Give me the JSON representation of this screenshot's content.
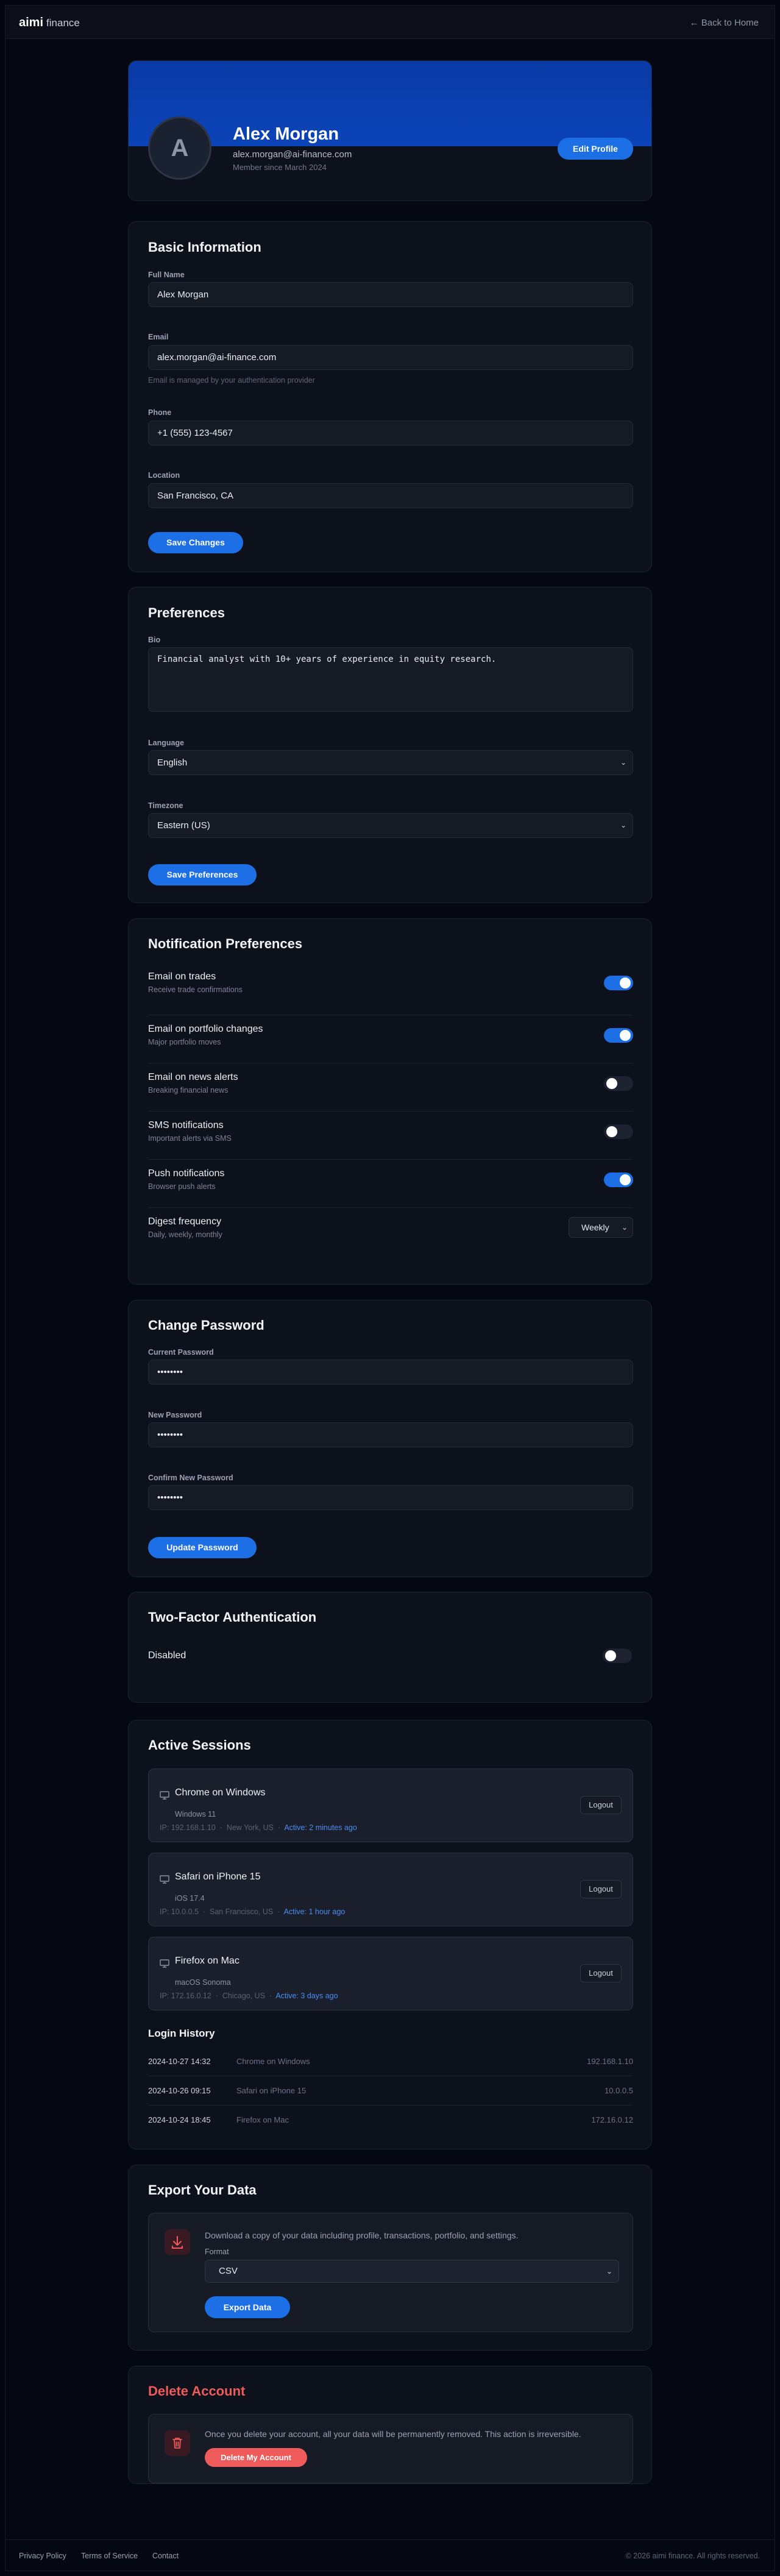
{
  "brand": {
    "logo": "aimi",
    "suffix": "finance"
  },
  "nav": {
    "back": "← Back to Home"
  },
  "profile": {
    "initial": "A",
    "name": "Alex Morgan",
    "email": "alex.morgan@ai-finance.com",
    "member_since": "Member since March 2024",
    "edit_label": "Edit Profile"
  },
  "basic": {
    "title": "Basic Information",
    "full_name": {
      "label": "Full Name",
      "value": "Alex Morgan"
    },
    "email": {
      "label": "Email",
      "value": "alex.morgan@ai-finance.com",
      "hint": "Email is managed by your authentication provider"
    },
    "phone": {
      "label": "Phone",
      "value": "+1 (555) 123-4567"
    },
    "location": {
      "label": "Location",
      "value": "San Francisco, CA"
    },
    "save_label": "Save Changes"
  },
  "prefs": {
    "title": "Preferences",
    "bio": {
      "label": "Bio",
      "value": "Financial analyst with 10+ years of experience in equity research."
    },
    "language": {
      "label": "Language",
      "value": "English"
    },
    "timezone": {
      "label": "Timezone",
      "value": "Eastern (US)"
    },
    "save_label": "Save Preferences"
  },
  "notifications": {
    "title": "Notification Preferences",
    "items": [
      {
        "title": "Email on trades",
        "subtitle": "Receive trade confirmations",
        "on": true
      },
      {
        "title": "Email on portfolio changes",
        "subtitle": "Major portfolio moves",
        "on": true
      },
      {
        "title": "Email on news alerts",
        "subtitle": "Breaking financial news",
        "on": false
      },
      {
        "title": "SMS notifications",
        "subtitle": "Important alerts via SMS",
        "on": false
      },
      {
        "title": "Push notifications",
        "subtitle": "Browser push alerts",
        "on": true
      }
    ],
    "digest": {
      "title": "Digest frequency",
      "subtitle": "Daily, weekly, monthly",
      "value": "Weekly"
    }
  },
  "password": {
    "title": "Change Password",
    "current": {
      "label": "Current Password",
      "value": "••••••••"
    },
    "new": {
      "label": "New Password",
      "value": "••••••••"
    },
    "confirm": {
      "label": "Confirm New Password",
      "value": "••••••••"
    },
    "update_label": "Update Password"
  },
  "twofa": {
    "title": "Two-Factor Authentication",
    "status": "Disabled",
    "on": false
  },
  "sessions": {
    "title": "Active Sessions",
    "logout_label": "Logout",
    "items": [
      {
        "device": "Chrome on Windows",
        "os": "Windows 11",
        "ip": "IP: 192.168.1.10",
        "location": "New York, US",
        "active": "Active: 2 minutes ago"
      },
      {
        "device": "Safari on iPhone 15",
        "os": "iOS 17.4",
        "ip": "IP: 10.0.0.5",
        "location": "San Francisco, US",
        "active": "Active: 1 hour ago"
      },
      {
        "device": "Firefox on Mac",
        "os": "macOS Sonoma",
        "ip": "IP: 172.16.0.12",
        "location": "Chicago, US",
        "active": "Active: 3 days ago"
      }
    ],
    "history_title": "Login History",
    "history": [
      {
        "date": "2024-10-27 14:32",
        "browser": "Chrome on Windows",
        "ip": "192.168.1.10"
      },
      {
        "date": "2024-10-26 09:15",
        "browser": "Safari on iPhone 15",
        "ip": "10.0.0.5"
      },
      {
        "date": "2024-10-24 18:45",
        "browser": "Firefox on Mac",
        "ip": "172.16.0.12"
      }
    ]
  },
  "export": {
    "title": "Export Your Data",
    "description": "Download a copy of your data including profile, transactions, portfolio, and settings.",
    "format_label": "Format",
    "format_value": "CSV",
    "button": "Export Data"
  },
  "delete": {
    "title": "Delete Account",
    "description": "Once you delete your account, all your data will be permanently removed. This action is irreversible.",
    "button": "Delete My Account"
  },
  "footer": {
    "links": [
      "Privacy Policy",
      "Terms of Service",
      "Contact"
    ],
    "copyright": "© 2026 aimi finance. All rights reserved."
  },
  "colors": {
    "accent": "#1d6fe6",
    "danger": "#ef5a5a",
    "background": "#040712",
    "card": "#0d111c"
  }
}
